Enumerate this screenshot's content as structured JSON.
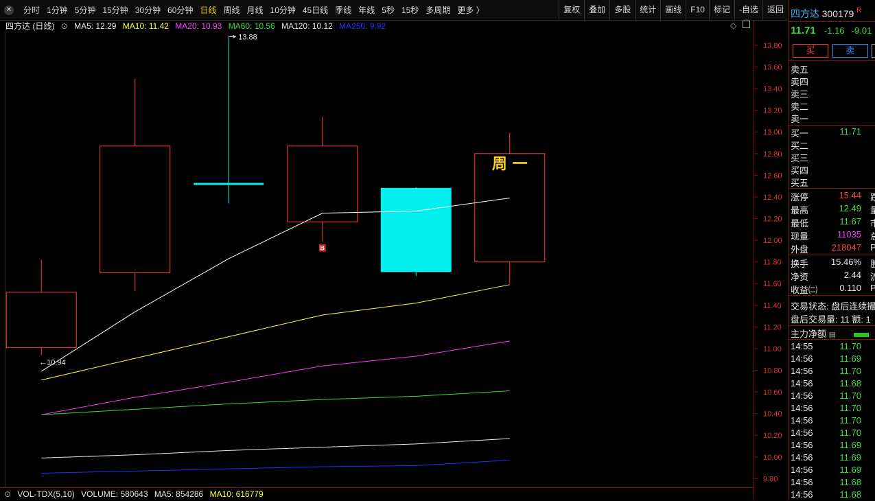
{
  "toolbar": {
    "periods": [
      "分时",
      "1分钟",
      "5分钟",
      "15分钟",
      "30分钟",
      "60分钟",
      "日线",
      "周线",
      "月线",
      "10分钟",
      "45日线",
      "季线",
      "年线",
      "5秒",
      "15秒",
      "多周期",
      "更多 〉"
    ],
    "active_period": "日线",
    "tools": [
      "复权",
      "叠加",
      "多股",
      "统计",
      "画线",
      "F10",
      "标记",
      "-自选",
      "返回"
    ]
  },
  "chart_header": {
    "name": "四方达 (日线)",
    "ma5": "MA5: 12.29",
    "ma10": "MA10: 11.42",
    "ma20": "MA20: 10.93",
    "ma60": "MA60: 10.56",
    "ma120": "MA120: 10.12",
    "ma250": "MA250: 9.92"
  },
  "colors": {
    "up": "#ff3c3c",
    "down": "#00f0f0",
    "ma5": "#ffffff",
    "ma10": "#ffff3c",
    "ma20": "#ff3cff",
    "ma60": "#3cdc3c",
    "ma120": "#e8e8e8",
    "ma250": "#2a2aff",
    "axis": "#7a1414"
  },
  "chart_data": {
    "type": "candlestick",
    "ylim": [
      9.72,
      13.92
    ],
    "y_ticks": [
      "13.80",
      "13.60",
      "13.40",
      "13.20",
      "13.00",
      "12.80",
      "12.60",
      "12.40",
      "12.20",
      "12.00",
      "11.80",
      "11.60",
      "11.40",
      "11.20",
      "11.00",
      "10.80",
      "10.60",
      "10.40",
      "10.20",
      "10.00",
      "9.80"
    ],
    "candles": [
      {
        "open": 11.01,
        "close": 11.52,
        "high": 11.82,
        "low": 10.94
      },
      {
        "open": 11.7,
        "close": 12.87,
        "high": 13.49,
        "low": 11.53
      },
      {
        "open": 12.52,
        "close": 12.52,
        "high": 13.88,
        "low": 12.34
      },
      {
        "open": 12.17,
        "close": 12.87,
        "high": 13.14,
        "low": 11.99
      },
      {
        "open": 12.48,
        "close": 11.71,
        "high": 12.49,
        "low": 11.67
      },
      {
        "open": 11.8,
        "close": 12.8,
        "high": 12.99,
        "low": 11.6
      }
    ],
    "ma5": [
      10.79,
      11.34,
      11.83,
      12.25,
      12.27,
      12.39
    ],
    "ma10": [
      10.71,
      10.91,
      11.11,
      11.31,
      11.42,
      11.59
    ],
    "ma20": [
      10.39,
      10.55,
      10.69,
      10.84,
      10.93,
      11.07
    ],
    "ma60": [
      10.39,
      10.44,
      10.49,
      10.53,
      10.56,
      10.61
    ],
    "ma120": [
      9.99,
      10.02,
      10.06,
      10.09,
      10.12,
      10.17
    ],
    "ma250": [
      9.85,
      9.87,
      9.89,
      9.91,
      9.92,
      9.97
    ],
    "annotations": {
      "high_label": "13.88",
      "low_label": "←10.94",
      "b_marker": "B",
      "weekday": "周 一"
    }
  },
  "volume_bar": {
    "name": "VOL-TDX(5,10)",
    "volume": "VOLUME: 580643",
    "ma5": "MA5: 854286",
    "ma10": "MA10: 616779"
  },
  "quote": {
    "name": "四方达",
    "code": "300179",
    "flag": "R",
    "price": "11.71",
    "change": "-1.16",
    "pct": "-9.01",
    "buy": "买",
    "sell": "卖",
    "asks": [
      "卖五",
      "卖四",
      "卖三",
      "卖二",
      "卖一"
    ],
    "bids": [
      {
        "label": "买一",
        "value": "11.71"
      },
      {
        "label": "买二",
        "value": ""
      },
      {
        "label": "买三",
        "value": ""
      },
      {
        "label": "买四",
        "value": ""
      },
      {
        "label": "买五",
        "value": ""
      }
    ],
    "stats": [
      {
        "label": "涨停",
        "value": "15.44",
        "suffix": "跌"
      },
      {
        "label": "最高",
        "value": "12.49",
        "suffix": "量"
      },
      {
        "label": "最低",
        "value": "11.67",
        "suffix": "市"
      },
      {
        "label": "现量",
        "value": "11035",
        "suffix": "总"
      },
      {
        "label": "外盘",
        "value": "218047",
        "suffix": "P"
      }
    ],
    "stats2": [
      {
        "label": "换手",
        "value": "15.46%",
        "suffix": "股"
      },
      {
        "label": "净资",
        "value": "2.44",
        "suffix": "流"
      },
      {
        "label": "收益㈡",
        "value": "0.110",
        "suffix": "P"
      }
    ],
    "trade_status": "交易状态: 盘后连续撮",
    "after_volume": "盘后交易量: 11  额: 1",
    "main_flow": "主力净额",
    "ticks": [
      {
        "time": "14:55",
        "price": "11.70"
      },
      {
        "time": "14:56",
        "price": "11.69"
      },
      {
        "time": "14:56",
        "price": "11.70"
      },
      {
        "time": "14:56",
        "price": "11.68"
      },
      {
        "time": "14:56",
        "price": "11.70"
      },
      {
        "time": "14:56",
        "price": "11.70"
      },
      {
        "time": "14:56",
        "price": "11.70"
      },
      {
        "time": "14:56",
        "price": "11.70"
      },
      {
        "time": "14:56",
        "price": "11.69"
      },
      {
        "time": "14:56",
        "price": "11.69"
      },
      {
        "time": "14:56",
        "price": "11.69"
      },
      {
        "time": "14:56",
        "price": "11.68"
      },
      {
        "time": "14:56",
        "price": "11.68"
      }
    ]
  }
}
